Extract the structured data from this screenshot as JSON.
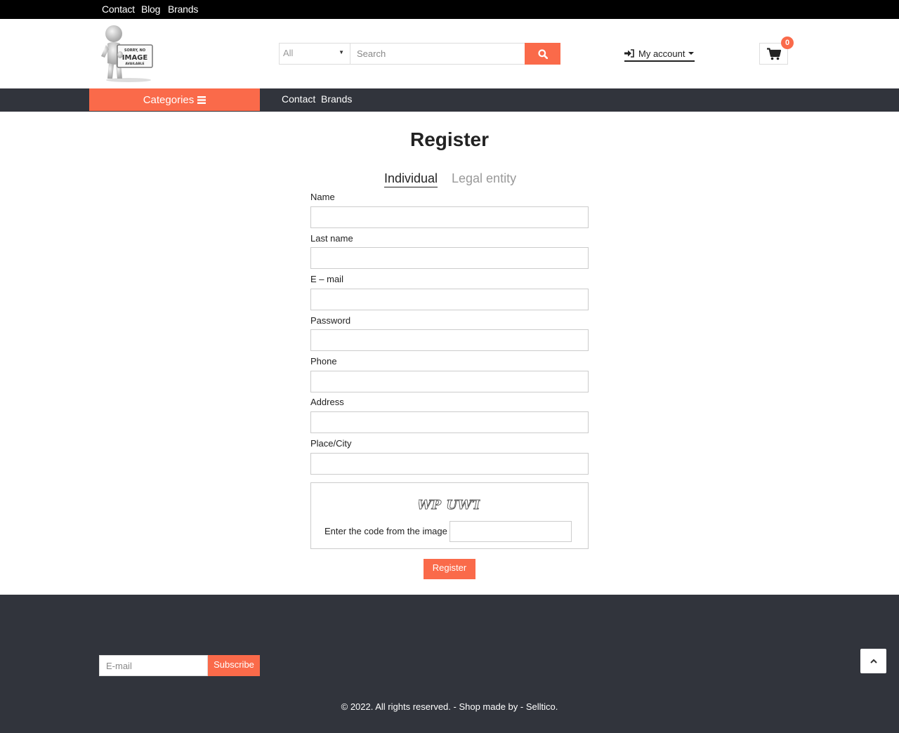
{
  "top_bar": {
    "links": [
      "Contact",
      "Blog",
      "Brands"
    ]
  },
  "logo": {
    "lines": [
      "SORRY, NO",
      "IMAGE",
      "AVAILABLE"
    ]
  },
  "search": {
    "category_value": "All",
    "placeholder": "Search",
    "button_icon": "search-icon"
  },
  "account": {
    "icon": "sign-in-icon",
    "label": "My account"
  },
  "cart": {
    "icon": "shopping-cart-icon",
    "count": "0"
  },
  "nav": {
    "categories_label": "Categories",
    "categories_icon": "hamburger-icon",
    "links": [
      "Contact",
      "Brands"
    ]
  },
  "register": {
    "title": "Register",
    "tabs": [
      "Individual",
      "Legal entity"
    ],
    "active_tab": "Individual",
    "fields": [
      {
        "label": "Name",
        "value": ""
      },
      {
        "label": "Last name",
        "value": ""
      },
      {
        "label": "E – mail",
        "value": ""
      },
      {
        "label": "Password",
        "value": ""
      },
      {
        "label": "Phone",
        "value": ""
      },
      {
        "label": "Address",
        "value": ""
      },
      {
        "label": "Place/City",
        "value": ""
      }
    ],
    "captcha": {
      "code": "WP UWT",
      "label": "Enter the code from the image",
      "value": ""
    },
    "submit_label": "Register"
  },
  "footer": {
    "newsletter_placeholder": "E-mail",
    "subscribe_label": "Subscribe",
    "back_to_top_icon": "chevron-up-icon",
    "copyright": "© 2022. All rights reserved. - Shop made by - Selltico."
  },
  "colors": {
    "accent": "#fa6a4a",
    "nav_bg": "#31343c",
    "top_bar_bg": "#000000"
  }
}
